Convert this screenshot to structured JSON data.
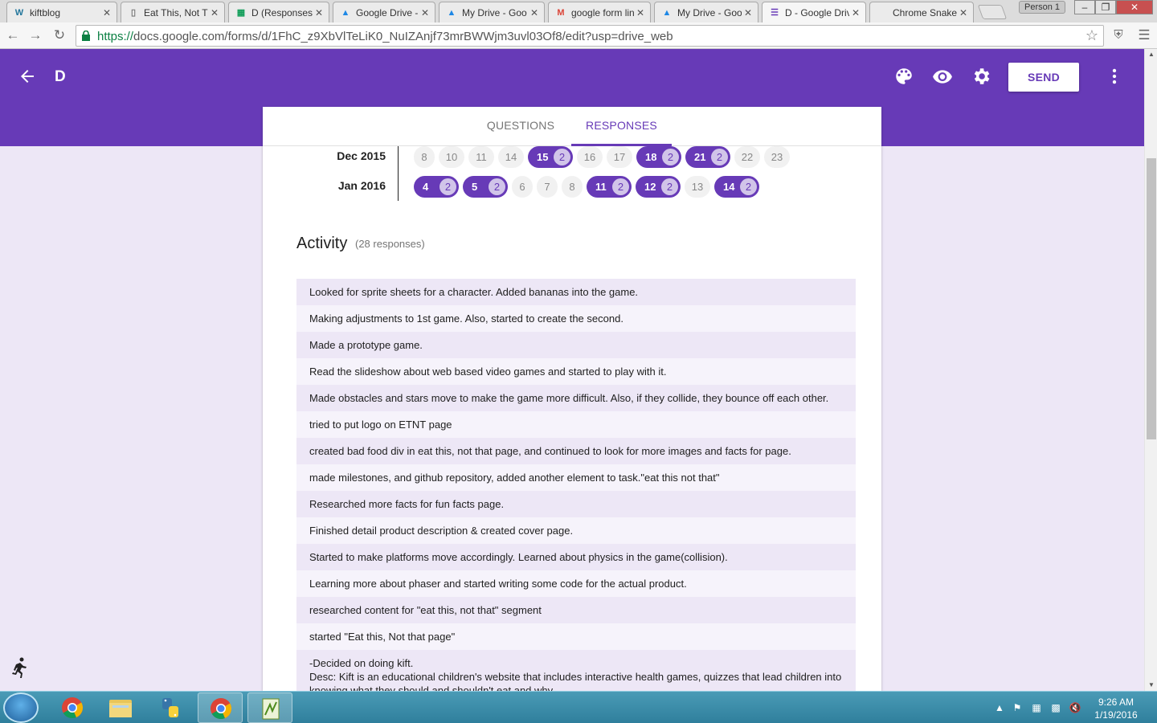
{
  "browser": {
    "tabs": [
      {
        "title": "kiftblog",
        "icon": "wordpress-icon"
      },
      {
        "title": "Eat This, Not Th",
        "icon": "document-icon"
      },
      {
        "title": "D (Responses)",
        "icon": "sheets-icon"
      },
      {
        "title": "Google Drive -",
        "icon": "drive-icon"
      },
      {
        "title": "My Drive - Goo",
        "icon": "drive-icon"
      },
      {
        "title": "google form lin",
        "icon": "gmail-icon"
      },
      {
        "title": "My Drive - Goo",
        "icon": "drive-icon"
      },
      {
        "title": "D - Google Driv",
        "icon": "forms-icon",
        "active": true
      },
      {
        "title": "Chrome Snake",
        "icon": "none"
      }
    ],
    "profile": "Person 1",
    "url_scheme": "https://",
    "url_rest": "docs.google.com/forms/d/1FhC_z9XbVlTeLiK0_NuIZAnjf73mrBWWjm3uvl03Of8/edit?usp=drive_web"
  },
  "form": {
    "title": "D",
    "send_label": "SEND",
    "accent": "#673ab7",
    "tabs": {
      "questions": "QUESTIONS",
      "responses": "RESPONSES"
    }
  },
  "timeline": [
    {
      "month": "Dec 2015",
      "days": [
        {
          "d": "8"
        },
        {
          "d": "10"
        },
        {
          "d": "11"
        },
        {
          "d": "14"
        },
        {
          "d": "15",
          "count": "2"
        },
        {
          "d": "16"
        },
        {
          "d": "17"
        },
        {
          "d": "18",
          "count": "2"
        },
        {
          "d": "21",
          "count": "2"
        },
        {
          "d": "22"
        },
        {
          "d": "23"
        }
      ]
    },
    {
      "month": "Jan 2016",
      "days": [
        {
          "d": "4",
          "count": "2"
        },
        {
          "d": "5",
          "count": "2"
        },
        {
          "d": "6"
        },
        {
          "d": "7"
        },
        {
          "d": "8"
        },
        {
          "d": "11",
          "count": "2"
        },
        {
          "d": "12",
          "count": "2"
        },
        {
          "d": "13"
        },
        {
          "d": "14",
          "count": "2"
        }
      ]
    }
  ],
  "activity": {
    "title": "Activity",
    "count_label": "(28 responses)",
    "responses": [
      "Looked for sprite sheets for a character. Added bananas into the game.",
      "Making adjustments to 1st game. Also, started to create the second.",
      "Made a prototype game.",
      "Read the slideshow about web based video games and started to play with it.",
      "Made obstacles and stars move to make the game more difficult. Also, if they collide, they bounce off each other.",
      "tried to put logo on ETNT page",
      "created bad food div in eat this, not that page, and continued to look for more images and facts for page.",
      "made milestones, and github repository, added another element to task.\"eat this not that\"",
      "Researched more facts for fun facts page.",
      "Finished detail product description & created cover page.",
      "Started to make platforms move accordingly. Learned about physics in the game(collision).",
      "Learning more about phaser and started writing some code for the actual product.",
      "researched content for \"eat this, not that\" segment",
      "started \"Eat this, Not that page\""
    ],
    "last_response_lines": [
      "-Decided on doing kift.",
      "Desc: Kift is an educational children's website that includes interactive health games, quizzes that lead children into",
      "knowing what they should and shouldn't eat and why."
    ]
  },
  "taskbar": {
    "apps": [
      "windows-start-icon",
      "chrome-icon",
      "file-explorer-icon",
      "python-icon",
      "chrome-icon",
      "notepad-plus-icon"
    ],
    "time": "9:26 AM",
    "date": "1/19/2016"
  }
}
